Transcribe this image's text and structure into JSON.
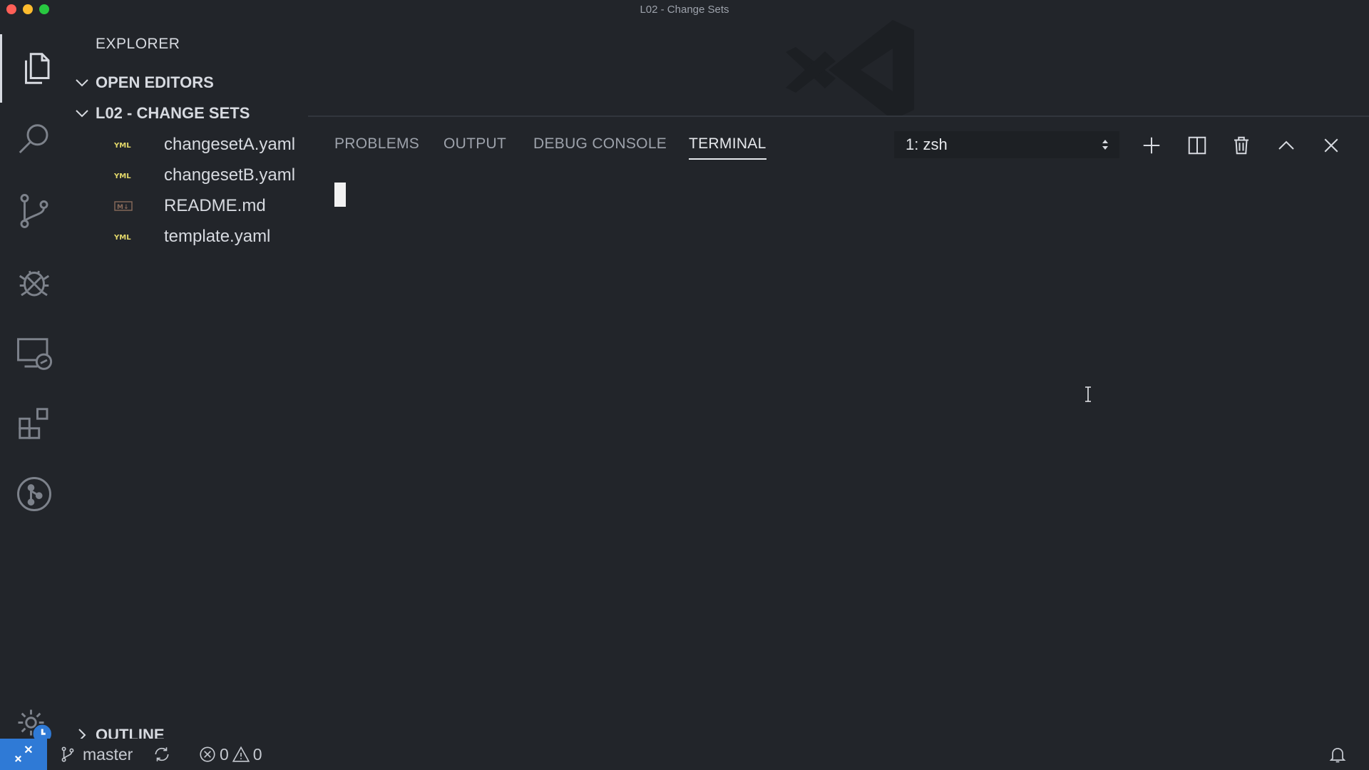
{
  "window": {
    "title": "L02 - Change Sets"
  },
  "activity_bar": {
    "items": [
      {
        "name": "explorer-icon"
      },
      {
        "name": "search-icon"
      },
      {
        "name": "source-control-icon"
      },
      {
        "name": "debug-icon"
      },
      {
        "name": "remote-explorer-icon"
      },
      {
        "name": "extensions-icon"
      },
      {
        "name": "git-graph-icon"
      }
    ],
    "settings": {
      "name": "gear-icon"
    }
  },
  "sidebar": {
    "title": "EXPLORER",
    "open_editors": "OPEN EDITORS",
    "folder": "L02 - CHANGE SETS",
    "files": [
      {
        "name": "changesetA.yaml",
        "icon": "yaml-file-icon"
      },
      {
        "name": "changesetB.yaml",
        "icon": "yaml-file-icon"
      },
      {
        "name": "README.md",
        "icon": "markdown-file-icon"
      },
      {
        "name": "template.yaml",
        "icon": "yaml-file-icon"
      }
    ],
    "outline": "OUTLINE"
  },
  "panel": {
    "tabs": [
      "PROBLEMS",
      "OUTPUT",
      "DEBUG CONSOLE",
      "TERMINAL"
    ],
    "active_tab": "TERMINAL",
    "terminal_select": "1: zsh"
  },
  "status_bar": {
    "branch": "master",
    "errors": "0",
    "warnings": "0"
  },
  "colors": {
    "background": "#22252a",
    "accent": "#2f7ad6",
    "yaml_icon": "#e3d86a"
  }
}
